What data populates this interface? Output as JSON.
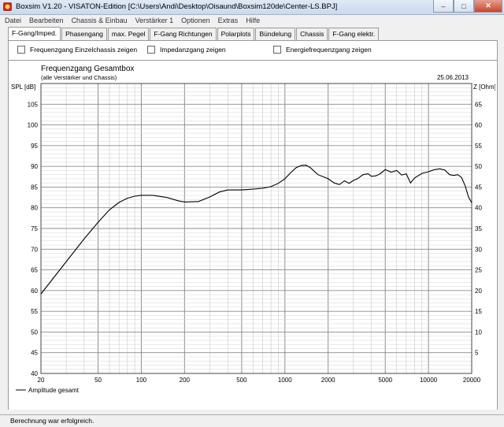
{
  "window": {
    "title": "Boxsim V1.20 - VISATON-Edition [C:\\Users\\Andi\\Desktop\\Oisaund\\Boxsim120de\\Center-LS.BPJ]"
  },
  "menu": [
    "Datei",
    "Bearbeiten",
    "Chassis & Einbau",
    "Verstärker 1",
    "Optionen",
    "Extras",
    "Hilfe"
  ],
  "tabs": [
    "F-Gang/Imped.",
    "Phasengang",
    "max. Pegel",
    "F-Gang Richtungen",
    "Polarplots",
    "Bündelung",
    "Chassis",
    "F-Gang elektr."
  ],
  "active_tab": "F-Gang/Imped.",
  "options": {
    "einzelchassis": "Frequenzgang Einzelchassis zeigen",
    "impedanz": "Impedanzgang zeigen",
    "energie": "Energiefrequenzgang zeigen"
  },
  "status": "Berechnung war erfolgreich.",
  "icons": [
    "app-icon",
    "minimize-icon",
    "maximize-icon",
    "close-icon"
  ],
  "chart_data": {
    "type": "line",
    "title": "Frequenzgang Gesamtbox",
    "subtitle": "(alle Verstärker und Chassis)",
    "date": "25.06.2013",
    "ylabel": "SPL [dB]",
    "ylabel_right": "Z [Ohm]",
    "xscale": "log",
    "xlim": [
      20,
      20000
    ],
    "ylim": [
      40,
      110
    ],
    "ylim_right": [
      0,
      70
    ],
    "xticks": [
      "20",
      "50",
      "100",
      "200",
      "500",
      "1000",
      "2000",
      "5000",
      "10000",
      "20000"
    ],
    "yticks": [
      "40",
      "45",
      "50",
      "55",
      "60",
      "65",
      "70",
      "75",
      "80",
      "85",
      "90",
      "95",
      "100",
      "105"
    ],
    "yticks_right": [
      "5",
      "10",
      "15",
      "20",
      "25",
      "30",
      "35",
      "40",
      "45",
      "50",
      "55",
      "60",
      "65"
    ],
    "grid": true,
    "legend": "bottom-left",
    "series": [
      {
        "name": "Amplitude gesamt",
        "color": "#000000",
        "x": [
          20,
          25,
          30,
          40,
          50,
          60,
          70,
          80,
          90,
          100,
          120,
          150,
          180,
          200,
          250,
          300,
          350,
          400,
          500,
          600,
          700,
          800,
          900,
          1000,
          1100,
          1200,
          1300,
          1400,
          1500,
          1700,
          2000,
          2200,
          2400,
          2600,
          2800,
          3000,
          3200,
          3500,
          3800,
          4000,
          4300,
          4600,
          5000,
          5500,
          6000,
          6500,
          7000,
          7500,
          8000,
          9000,
          10000,
          11000,
          12000,
          13000,
          14000,
          15000,
          16000,
          17000,
          18000,
          19000,
          20000
        ],
        "y": [
          59.2,
          63.5,
          67.0,
          72.5,
          76.5,
          79.5,
          81.3,
          82.3,
          82.8,
          83.0,
          83.0,
          82.5,
          81.7,
          81.4,
          81.5,
          82.6,
          83.8,
          84.3,
          84.3,
          84.5,
          84.7,
          85.1,
          85.9,
          87.0,
          88.5,
          89.7,
          90.2,
          90.3,
          89.7,
          88.0,
          87.0,
          86.0,
          85.6,
          86.5,
          85.9,
          86.6,
          87.0,
          88.0,
          88.2,
          87.6,
          87.7,
          88.2,
          89.2,
          88.6,
          89.0,
          87.9,
          88.2,
          86.0,
          87.2,
          88.3,
          88.7,
          89.2,
          89.4,
          89.1,
          88.0,
          87.8,
          88.0,
          87.3,
          85.3,
          82.6,
          81.2
        ]
      }
    ]
  }
}
